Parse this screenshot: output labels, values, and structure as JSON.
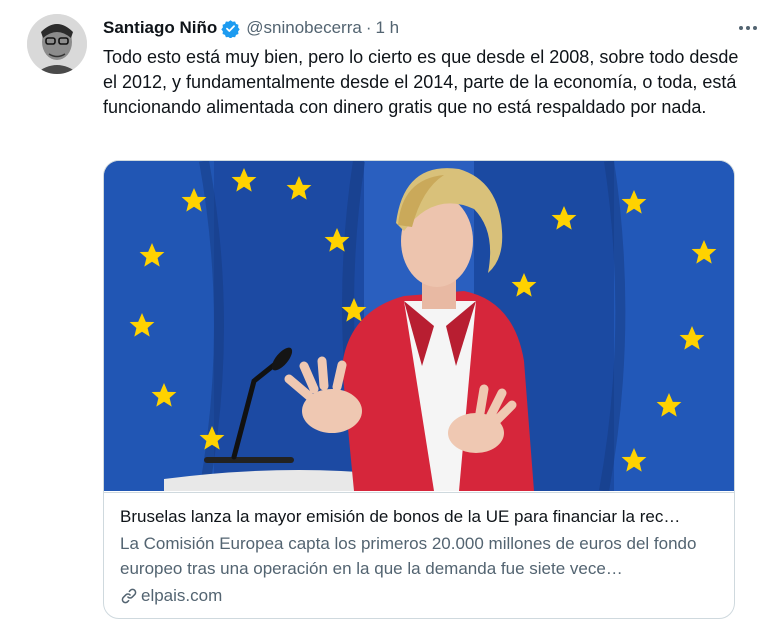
{
  "author": {
    "name": "Santiago Niño",
    "handle": "@sninobecerra",
    "separator": "·",
    "time": "1 h",
    "verified": true
  },
  "tweet": {
    "text": "Todo esto está muy bien, pero lo cierto es que desde el 2008, sobre todo desde el 2012, y fundamentalmente desde el 2014, parte de la economía, o toda, está funcionando alimentada con dinero gratis que no está respaldado por nada."
  },
  "card": {
    "title": "Bruselas lanza la mayor emisión de bonos de la UE para financiar la rec…",
    "description": "La Comisión Europea capta los primeros 20.000 millones de euros del fondo europeo tras una operación en la que la demanda fue siete vece…",
    "domain": "elpais.com"
  },
  "icons": {
    "verified": "verified-badge-icon",
    "more": "more-options-icon",
    "link": "link-icon"
  },
  "colors": {
    "verified_blue": "#1d9bf0",
    "secondary_text": "#536471",
    "eu_blue": "#1f4fa6",
    "eu_star": "#ffd200",
    "jacket_red": "#d6263b"
  }
}
